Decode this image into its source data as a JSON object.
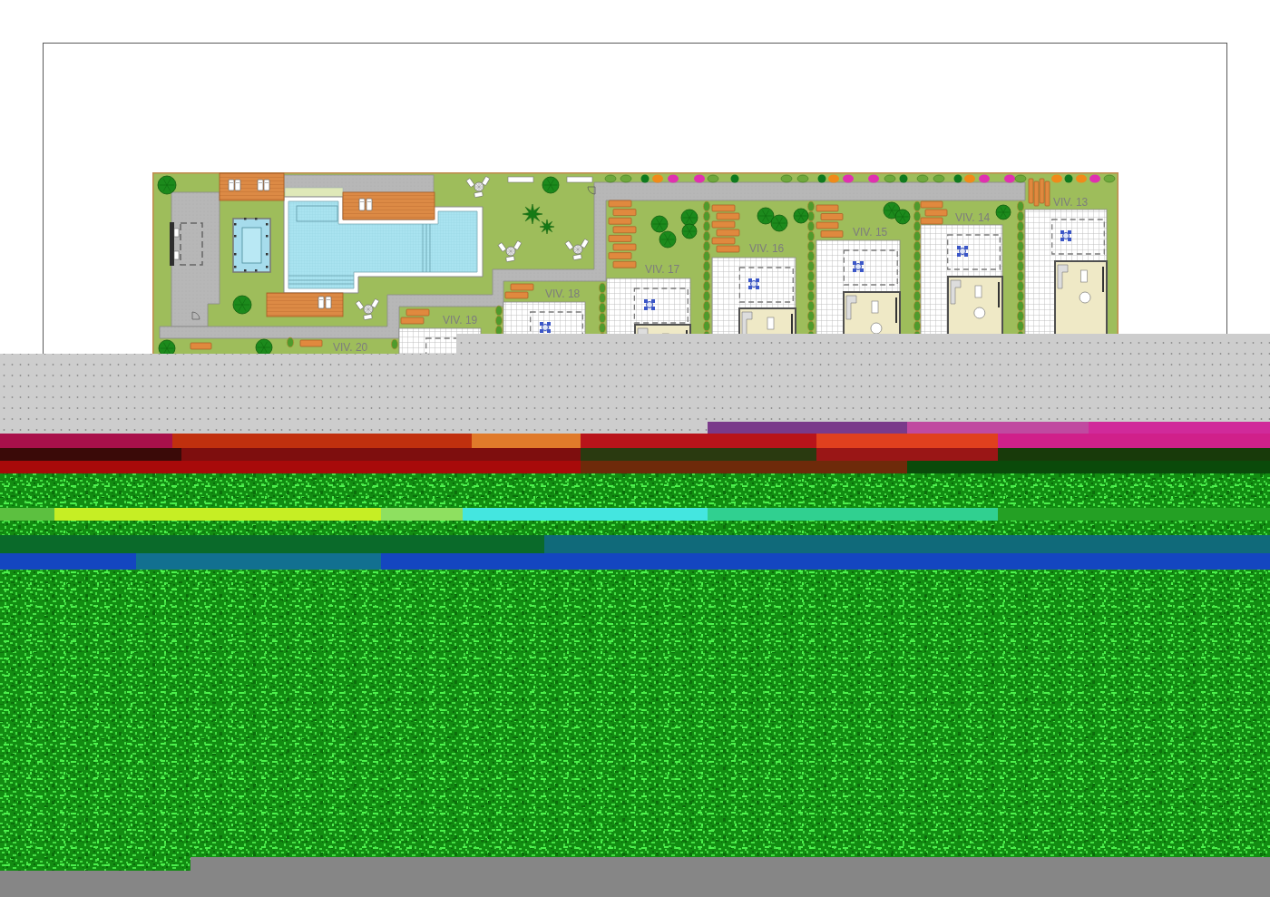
{
  "plan": {
    "units": [
      {
        "label": "VIV. 13"
      },
      {
        "label": "VIV. 14"
      },
      {
        "label": "VIV. 15"
      },
      {
        "label": "VIV. 16"
      },
      {
        "label": "VIV. 17"
      },
      {
        "label": "VIV. 18"
      },
      {
        "label": "VIV. 19"
      },
      {
        "label": "VIV. 20"
      }
    ]
  }
}
